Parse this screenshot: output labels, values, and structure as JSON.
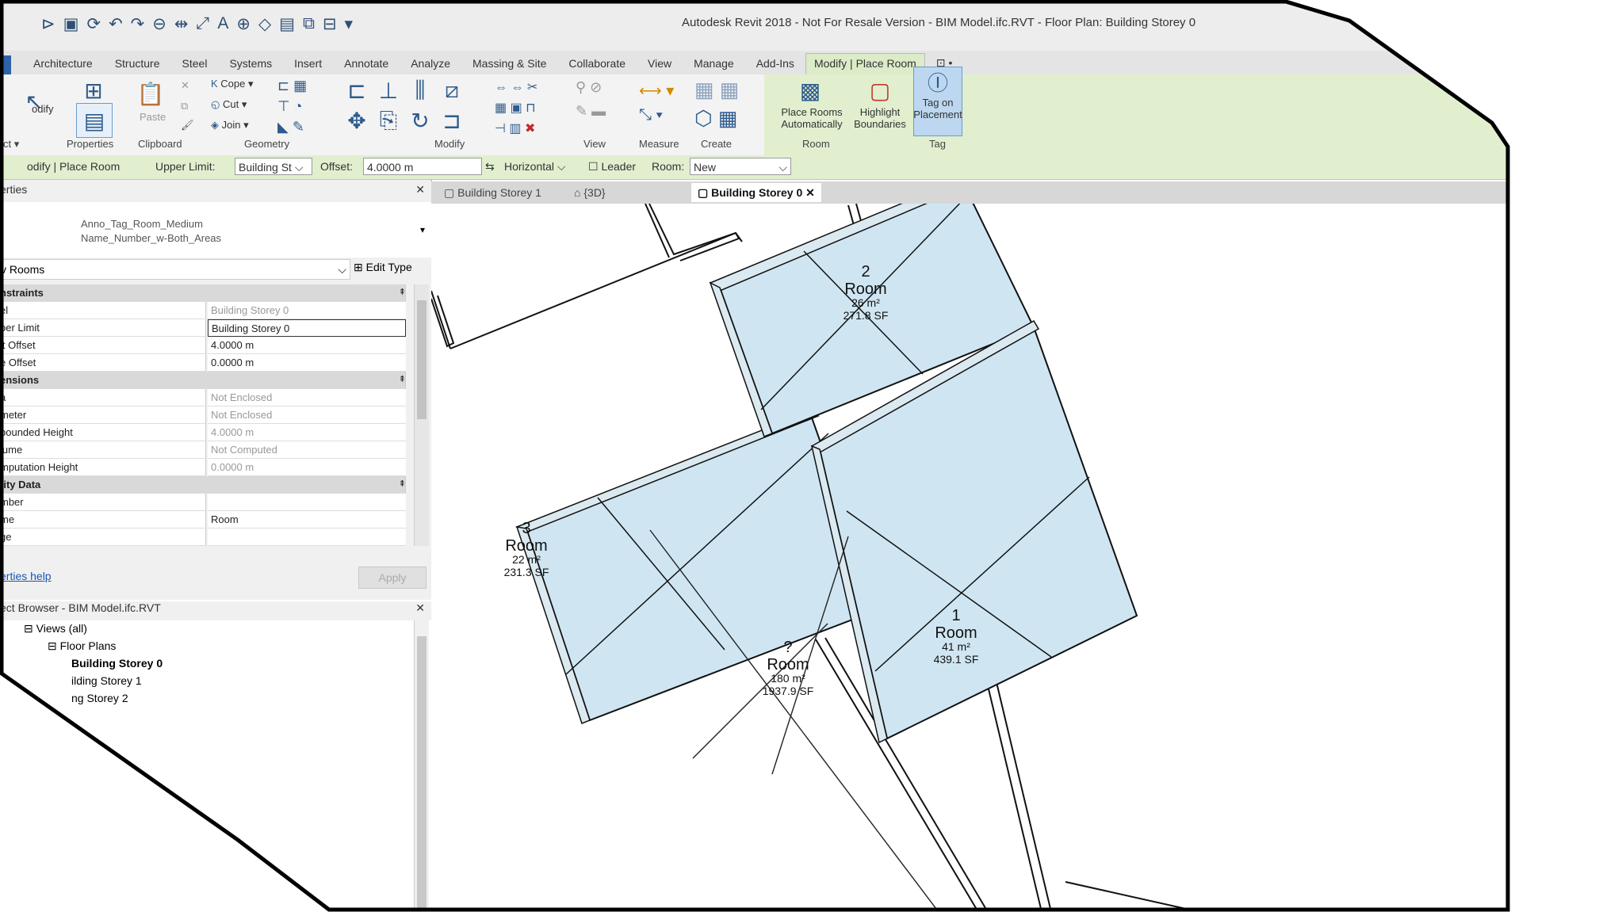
{
  "window": {
    "title": "Autodesk Revit 2018 - Not For Resale Version - BIM Model.ifc.RVT - Floor Plan: Building Storey 0"
  },
  "ribbon": {
    "tabs": [
      "Architecture",
      "Structure",
      "Steel",
      "Systems",
      "Insert",
      "Annotate",
      "Analyze",
      "Massing & Site",
      "Collaborate",
      "View",
      "Manage",
      "Add-Ins",
      "Modify | Place Room",
      "⊡ •"
    ],
    "active_tab": "Modify | Place Room",
    "modify_label": "odify",
    "clipboard": {
      "paste": "Paste"
    },
    "geometry": {
      "cope": "Cope",
      "cut": "Cut",
      "join": "Join"
    },
    "room": {
      "place_auto": "Place Rooms Automatically",
      "highlight": "Highlight Boundaries"
    },
    "tag": {
      "tag_on_placement": "Tag on Placement"
    },
    "groups": [
      "ct ▾",
      "Properties",
      "Clipboard",
      "Geometry",
      "Modify",
      "View",
      "Measure",
      "Create",
      "Room",
      "Tag"
    ]
  },
  "options_bar": {
    "context": "odify | Place Room",
    "upper_limit_label": "Upper Limit:",
    "upper_limit_value": "Building St",
    "offset_label": "Offset:",
    "offset_value": "4.0000 m",
    "orientation": "Horizontal",
    "leader_label": "Leader",
    "room_label": "Room:",
    "room_value": "New"
  },
  "properties": {
    "header": "erties",
    "type_name_line1": "Anno_Tag_Room_Medium",
    "type_name_line2": "Name_Number_w-Both_Areas",
    "selector": "v Rooms",
    "edit_type": "Edit Type",
    "rows": [
      {
        "section": "nstraints"
      },
      {
        "name": "el",
        "value": "Building Storey 0"
      },
      {
        "name": "per Limit",
        "value": "Building Storey 0",
        "editable": true
      },
      {
        "name": "it Offset",
        "value": "4.0000 m",
        "editable": true
      },
      {
        "name": "e Offset",
        "value": "0.0000 m",
        "editable": true
      },
      {
        "section": "ensions"
      },
      {
        "name": "a",
        "value": "Not Enclosed"
      },
      {
        "name": "meter",
        "value": "Not Enclosed"
      },
      {
        "name": "bounded Height",
        "value": "4.0000 m"
      },
      {
        "name": "lume",
        "value": "Not Computed"
      },
      {
        "name": "mputation Height",
        "value": "0.0000 m"
      },
      {
        "section": "tity Data"
      },
      {
        "name": "mber",
        "value": ""
      },
      {
        "name": "me",
        "value": "Room",
        "editable": true
      },
      {
        "name": "ge",
        "value": ""
      }
    ],
    "help_link": "erties help",
    "apply": "Apply"
  },
  "project_browser": {
    "header": "ect Browser - BIM Model.ifc.RVT",
    "items": [
      {
        "label": "Views (all)",
        "indent": 1,
        "bold": false
      },
      {
        "label": "Floor Plans",
        "indent": 2,
        "bold": false
      },
      {
        "label": "Building Storey 0",
        "indent": 3,
        "bold": true
      },
      {
        "label": "ilding Storey 1",
        "indent": 3,
        "bold": false
      },
      {
        "label": "ng Storey 2",
        "indent": 3,
        "bold": false
      }
    ]
  },
  "view_tabs": [
    {
      "label": "Building Storey 1",
      "active": false
    },
    {
      "label": "{3D}",
      "active": false
    },
    {
      "label": "Building Storey 0",
      "active": true
    }
  ],
  "rooms": [
    {
      "number": "2",
      "name": "Room",
      "area_m2": "26 m²",
      "area_sf": "271.8 SF",
      "placed": true
    },
    {
      "number": "3",
      "name": "Room",
      "area_m2": "22 m²",
      "area_sf": "231.3 SF",
      "placed": true
    },
    {
      "number": "?",
      "name": "Room",
      "area_m2": "180 m²",
      "area_sf": "1937.9 SF",
      "placed": false
    },
    {
      "number": "1",
      "name": "Room",
      "area_m2": "41 m²",
      "area_sf": "439.1 SF",
      "placed": true
    }
  ],
  "colors": {
    "room_fill": "#cfe6f2",
    "context_ribbon": "#e1efcf",
    "outline": "#111111"
  }
}
